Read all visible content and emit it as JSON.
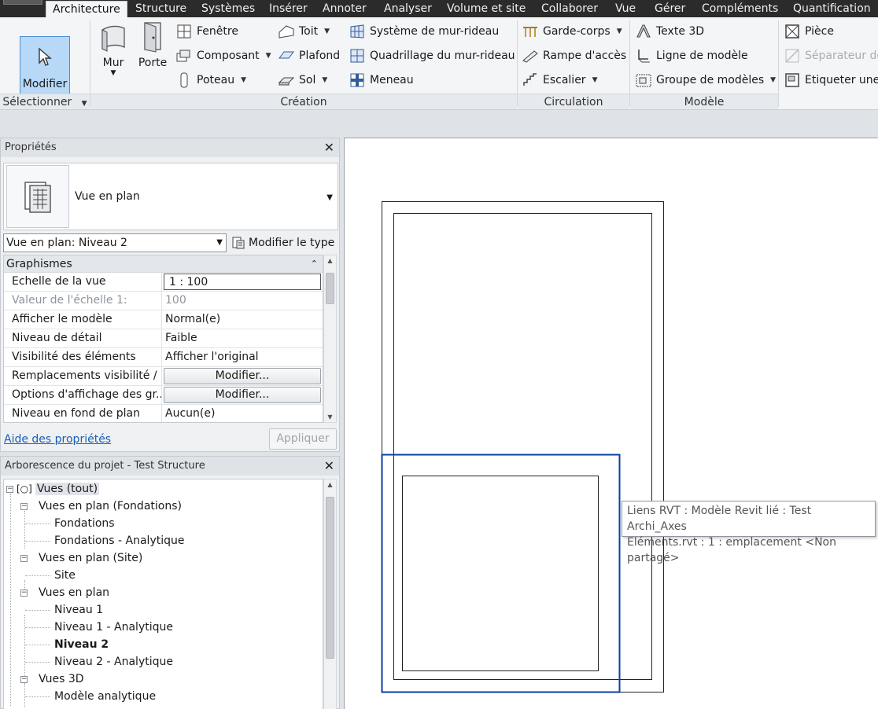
{
  "ribbon": {
    "tabs": [
      "Architecture",
      "Structure",
      "Systèmes",
      "Insérer",
      "Annoter",
      "Analyser",
      "Volume et site",
      "Collaborer",
      "Vue",
      "Gérer",
      "Compléments",
      "Quantification"
    ],
    "active_tab": "Architecture",
    "select_panel": {
      "modify_label": "Modifier",
      "title": "Sélectionner"
    },
    "create_panel": {
      "title": "Création",
      "wall_label": "Mur",
      "door_label": "Porte",
      "window_label": "Fenêtre",
      "component_label": "Composant",
      "column_label": "Poteau",
      "roof_label": "Toit",
      "ceiling_label": "Plafond",
      "floor_label": "Sol",
      "curtain_system_label": "Système de mur-rideau",
      "curtain_grid_label": "Quadrillage du mur-rideau",
      "mullion_label": "Meneau"
    },
    "circulation_panel": {
      "title": "Circulation",
      "railing_label": "Garde-corps",
      "ramp_label": "Rampe d'accès",
      "stair_label": "Escalier"
    },
    "model_panel": {
      "title": "Modèle",
      "text3d_label": "Texte 3D",
      "model_line_label": "Ligne de modèle",
      "model_group_label": "Groupe de modèles"
    },
    "room_panel": {
      "room_label": "Pièce",
      "separator_label": "Séparateur de",
      "tag_label": "Etiqueter une"
    }
  },
  "properties": {
    "title": "Propriétés",
    "type_name": "Vue en plan",
    "instance_selector": "Vue en plan: Niveau 2",
    "edit_type_label": "Modifier le type",
    "group_label": "Graphismes",
    "rows": [
      {
        "key": "Echelle de la vue",
        "value": "1 : 100"
      },
      {
        "key": "Valeur de l'échelle    1:",
        "value": "100"
      },
      {
        "key": "Afficher le modèle",
        "value": "Normal(e)"
      },
      {
        "key": "Niveau de détail",
        "value": "Faible"
      },
      {
        "key": "Visibilité des éléments",
        "value": "Afficher l'original"
      },
      {
        "key": "Remplacements visibilité / ...",
        "value": "Modifier..."
      },
      {
        "key": "Options d'affichage des gr...",
        "value": "Modifier..."
      },
      {
        "key": "Niveau en fond de plan",
        "value": "Aucun(e)"
      }
    ],
    "help_link": "Aide des propriétés",
    "apply_label": "Appliquer"
  },
  "browser": {
    "title": "Arborescence du projet - Test Structure",
    "nodes": [
      "Vues (tout)",
      "Vues en plan (Fondations)",
      "Fondations",
      "Fondations - Analytique",
      "Vues en plan (Site)",
      "Site",
      "Vues en plan",
      "Niveau 1",
      "Niveau 1 - Analytique",
      "Niveau 2",
      "Niveau 2 - Analytique",
      "Vues 3D",
      "Modèle analytique"
    ]
  },
  "canvas": {
    "tooltip_line1": "Liens RVT : Modèle Revit lié : Test Archi_Axes",
    "tooltip_line2": "Eléments.rvt : 1 : emplacement <Non partagé>",
    "highlight_color": "#0a3ea6"
  },
  "colors": {
    "ribbon_tabbar": "#2b2b2b",
    "modify_active": "#b7d8f7",
    "link": "#1a5fb4"
  }
}
